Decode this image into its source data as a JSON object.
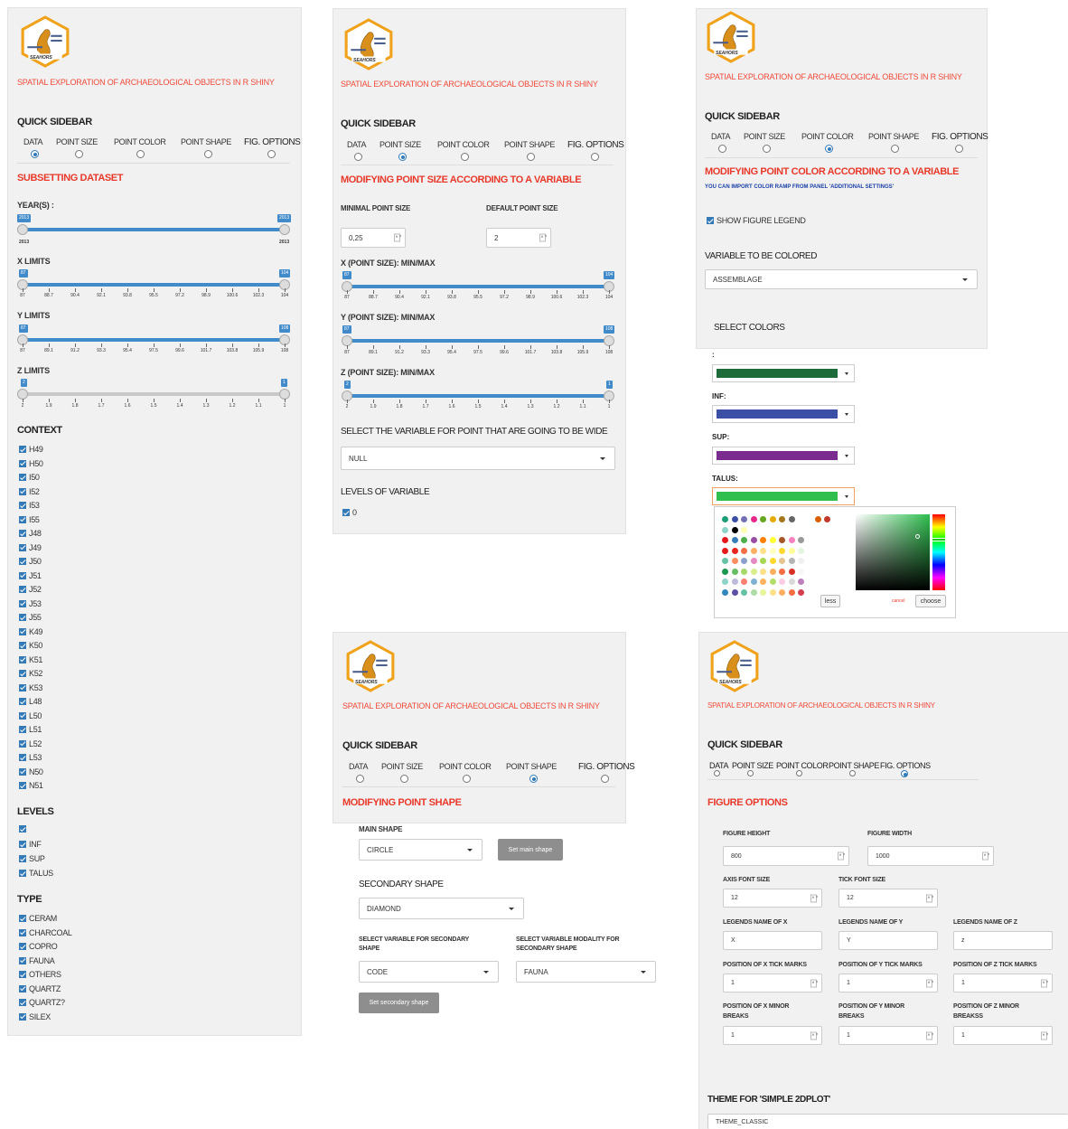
{
  "app_title": "SPATIAL EXPLORATION OF ARCHAEOLOGICAL OBJECTS IN R SHINY",
  "logo_text": "SEAHORS",
  "sidebar_title": "QUICK SIDEBAR",
  "tabs": [
    "DATA",
    "POINT SIZE",
    "POINT COLOR",
    "POINT SHAPE",
    "FIG. OPTIONS"
  ],
  "panel1": {
    "section_title": "SUBSETTING DATASET",
    "year_label": "YEAR(S) :",
    "year_min": "2013",
    "year_max": "2013",
    "year_flag_left": "2013",
    "year_flag_right": "2013",
    "x_label": "X LIMITS",
    "x_flag_left": "87",
    "x_flag_right": "104",
    "x_ticks": [
      "87",
      "88.7",
      "90.4",
      "92.1",
      "93.8",
      "95.5",
      "97.2",
      "98.9",
      "100.6",
      "102.3",
      "104"
    ],
    "y_label": "Y LIMITS",
    "y_flag_left": "87",
    "y_flag_right": "108",
    "y_ticks": [
      "87",
      "89.1",
      "91.2",
      "93.3",
      "95.4",
      "97.5",
      "99.6",
      "101.7",
      "103.8",
      "105.9",
      "108"
    ],
    "z_label": "Z LIMITS",
    "z_flag_left": "2",
    "z_flag_right": "1",
    "z_ticks": [
      "2",
      "1.9",
      "1.8",
      "1.7",
      "1.6",
      "1.5",
      "1.4",
      "1.3",
      "1.2",
      "1.1",
      "1"
    ],
    "context_title": "CONTEXT",
    "context_items": [
      "H49",
      "H50",
      "I50",
      "I52",
      "I53",
      "I55",
      "J48",
      "J49",
      "J50",
      "J51",
      "J52",
      "J53",
      "J55",
      "K49",
      "K50",
      "K51",
      "K52",
      "K53",
      "L48",
      "L50",
      "L51",
      "L52",
      "L53",
      "N50",
      "N51"
    ],
    "levels_title": "LEVELS",
    "levels_items": [
      "",
      "INF",
      "SUP",
      "TALUS"
    ],
    "type_title": "TYPE",
    "type_items": [
      "CERAM",
      "CHARCOAL",
      "COPRO",
      "FAUNA",
      "OTHERS",
      "QUARTZ",
      "QUARTZ?",
      "SILEX"
    ]
  },
  "panel2": {
    "section_title": "MODIFYING POINT SIZE ACCORDING TO A VARIABLE",
    "min_label": "MINIMAL POINT SIZE",
    "min_value": "0,25",
    "default_label": "DEFAULT POINT SIZE",
    "default_value": "2",
    "x_label": "X (POINT SIZE): MIN/MAX",
    "x_flag_left": "87",
    "x_flag_right": "104",
    "x_ticks": [
      "87",
      "88.7",
      "90.4",
      "92.1",
      "93.8",
      "95.5",
      "97.2",
      "98.9",
      "100.6",
      "102.3",
      "104"
    ],
    "y_label": "Y (POINT SIZE): MIN/MAX",
    "y_flag_left": "87",
    "y_flag_right": "108",
    "y_ticks": [
      "87",
      "89.1",
      "91.2",
      "93.3",
      "95.4",
      "97.5",
      "99.6",
      "101.7",
      "103.8",
      "105.9",
      "108"
    ],
    "z_label": "Z (POINT SIZE): MIN/MAX",
    "z_flag_left": "2",
    "z_flag_right": "1",
    "z_ticks": [
      "2",
      "1.9",
      "1.8",
      "1.7",
      "1.6",
      "1.5",
      "1.4",
      "1.3",
      "1.2",
      "1.1",
      "1"
    ],
    "select_label": "SELECT THE VARIABLE FOR POINT THAT ARE GOING TO BE WIDE",
    "select_value": "NULL",
    "levels_label": "LEVELS OF VARIABLE",
    "levels_value": "0"
  },
  "panel3": {
    "section_title": "MODIFYING POINT COLOR ACCORDING TO A VARIABLE",
    "hint": "YOU CAN IMPORT COLOR RAMP FROM PANEL 'ADDITIONAL SETTINGS'",
    "legend_label": "SHOW FIGURE LEGEND",
    "variable_label": "VARIABLE TO BE COLORED",
    "variable_value": "ASSEMBLAGE",
    "colors_label": "SELECT COLORS",
    "color_rows": [
      {
        "label": ":",
        "color": "#1e6b3a"
      },
      {
        "label": "INF:",
        "color": "#3b4fa6"
      },
      {
        "label": "SUP:",
        "color": "#7b2a8e"
      },
      {
        "label": "TALUS:",
        "color": "#2fbf4f"
      }
    ],
    "less_label": "less",
    "cancel_label": "cancel",
    "choose_label": "choose",
    "palette": [
      [
        "#1b9e77",
        "#3b4fa6",
        "#7570b3",
        "#e7298a",
        "#66a61e",
        "#e6ab02",
        "#a6761d",
        "#666666",
        "#ffffff",
        "#d95f02",
        "#c0392b"
      ],
      [
        "#8dd3c7",
        "#000000",
        "#ffffb3"
      ],
      [
        "#e41a1c",
        "#377eb8",
        "#4daf4a",
        "#984ea3",
        "#ff7f00",
        "#ffff33",
        "#a65628",
        "#f781bf",
        "#999999"
      ],
      [
        "#e41a1c",
        "#e6261f",
        "#f46d43",
        "#fdae61",
        "#fee08b",
        "#ffffbf",
        "#ffd92f",
        "#ffff99",
        "#e5f5e0"
      ],
      [
        "#66c2a5",
        "#fc8d62",
        "#8da0cb",
        "#e78ac3",
        "#a6d854",
        "#ffd92f",
        "#e5c494",
        "#b3b3b3",
        "#f0f0f0"
      ],
      [
        "#1a9850",
        "#66bd63",
        "#a6d96a",
        "#d9ef8b",
        "#fee08b",
        "#fdae61",
        "#f46d43",
        "#d73027",
        "#f7f7f7"
      ],
      [
        "#8dd3c7",
        "#bebada",
        "#fb8072",
        "#80b1d3",
        "#fdb462",
        "#b3de69",
        "#fccde5",
        "#d9d9d9",
        "#bc80bd"
      ],
      [
        "#3288bd",
        "#5e4fa2",
        "#66c2a5",
        "#abdda4",
        "#e6f598",
        "#fee08b",
        "#fdae61",
        "#f46d43",
        "#d53e4f"
      ]
    ]
  },
  "panel4": {
    "section_title": "MODIFYING POINT SHAPE",
    "main_label": "MAIN SHAPE",
    "main_value": "CIRCLE",
    "main_button": "Set main shape",
    "secondary_label": "SECONDARY SHAPE",
    "secondary_value": "DIAMOND",
    "var_label": "SELECT VARIABLE FOR SECONDARY SHAPE",
    "var_value": "CODE",
    "mod_label": "SELECT VARIABLE MODALITY FOR SECONDARY SHAPE",
    "mod_value": "FAUNA",
    "secondary_button": "Set secondary shape"
  },
  "panel5": {
    "section_title": "FIGURE OPTIONS",
    "height_label": "FIGURE HEIGHT",
    "height_value": "800",
    "width_label": "FIGURE WIDTH",
    "width_value": "1000",
    "axis_font_label": "AXIS FONT SIZE",
    "axis_font_value": "12",
    "tick_font_label": "TICK FONT SIZE",
    "tick_font_value": "12",
    "legend_x_label": "LEGENDS NAME OF X",
    "legend_x_value": "X",
    "legend_y_label": "LEGENDS NAME OF Y",
    "legend_y_value": "Y",
    "legend_z_label": "LEGENDS NAME OF Z",
    "legend_z_value": "Z",
    "pos_x_label": "POSITION OF X TICK MARKS",
    "pos_x_value": "1",
    "pos_y_label": "POSITION OF Y TICK MARKS",
    "pos_y_value": "1",
    "pos_z_label": "POSITION OF Z TICK MARKS",
    "pos_z_value": "1",
    "minor_x_label": "POSITION OF X MINOR BREAKS",
    "minor_x_value": "1",
    "minor_y_label": "POSITION OF Y MINOR BREAKS",
    "minor_y_value": "1",
    "minor_z_label": "POSITION OF Z MINOR BREAKSS",
    "minor_z_value": "1",
    "theme_label": "THEME FOR 'SIMPLE 2DPLOT'",
    "theme_value": "THEME_CLASSIC"
  }
}
